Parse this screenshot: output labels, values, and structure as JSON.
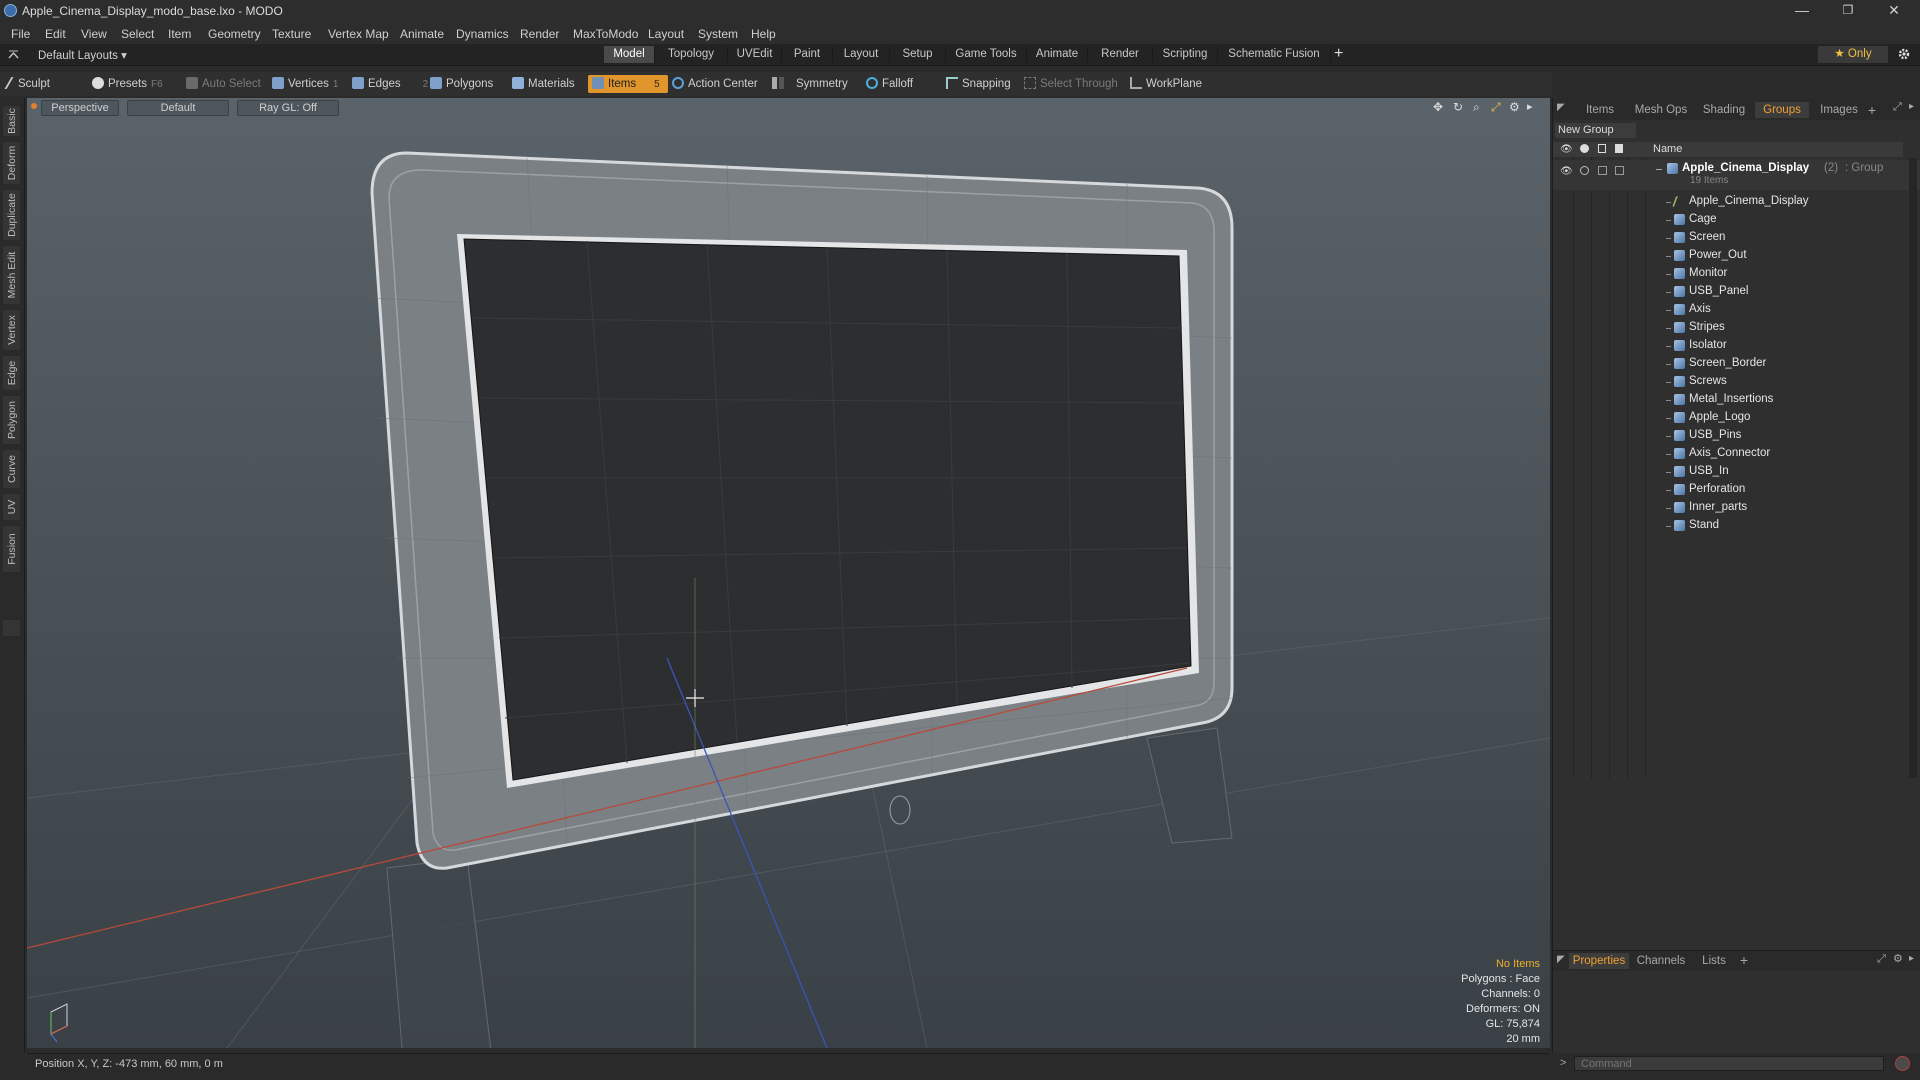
{
  "window": {
    "title": "Apple_Cinema_Display_modo_base.lxo - MODO",
    "controls": {
      "minimize": "—",
      "maximize": "❐",
      "close": "✕"
    }
  },
  "menu": [
    "File",
    "Edit",
    "View",
    "Select",
    "Item",
    "Geometry",
    "Texture",
    "Vertex Map",
    "Animate",
    "Dynamics",
    "Render",
    "MaxToModo",
    "Layout",
    "System",
    "Help"
  ],
  "layoutbar": {
    "layouts_label": "Default Layouts ▾",
    "tabs": [
      "Model",
      "Topology",
      "UVEdit",
      "Paint",
      "Layout",
      "Setup",
      "Game Tools",
      "Animate",
      "Render",
      "Scripting",
      "Schematic Fusion"
    ],
    "active_tab": "Model",
    "add_label": "+",
    "only_label": "★ Only"
  },
  "toolbar": {
    "sculpt": "Sculpt",
    "presets": "Presets",
    "presets_key": "F6",
    "auto_select": "Auto Select",
    "vertices": "Vertices",
    "vertices_key": "1",
    "edges": "Edges",
    "edges_key": "2",
    "polygons": "Polygons",
    "materials": "Materials",
    "items": "Items",
    "items_key": "5",
    "action_center": "Action Center",
    "symmetry": "Symmetry",
    "falloff": "Falloff",
    "snapping": "Snapping",
    "select_through": "Select Through",
    "workplane": "WorkPlane"
  },
  "lefttabs": [
    "Basic",
    "Deform",
    "Duplicate",
    "Mesh Edit",
    "Vertex",
    "Edge",
    "Polygon",
    "Curve",
    "UV",
    "Fusion"
  ],
  "viewport": {
    "view_label": "Perspective",
    "shading_label": "Default",
    "raygl_label": "Ray GL: Off",
    "info": {
      "selection": "No Items",
      "polygons": "Polygons : Face",
      "channels": "Channels: 0",
      "deformers": "Deformers: ON",
      "gl": "GL: 75,874",
      "unit": "20 mm"
    }
  },
  "statusbar": {
    "position": "Position X, Y, Z:  -473 mm, 60 mm, 0 m"
  },
  "rightpanel": {
    "tabs": [
      "Items",
      "Mesh Ops",
      "Shading",
      "Groups",
      "Images"
    ],
    "active_tab": "Groups",
    "add_tab": "+",
    "new_group": "New Group",
    "column_name": "Name",
    "group": {
      "name": "Apple_Cinema_Display",
      "count": "(2)",
      "type": ": Group",
      "sub": "19 Items"
    },
    "items": [
      "Apple_Cinema_Display",
      "Cage",
      "Screen",
      "Power_Out",
      "Monitor",
      "USB_Panel",
      "Axis",
      "Stripes",
      "Isolator",
      "Screen_Border",
      "Screws",
      "Metal_Insertions",
      "Apple_Logo",
      "USB_Pins",
      "Axis_Connector",
      "USB_In",
      "Perforation",
      "Inner_parts",
      "Stand"
    ],
    "bottom_tabs": [
      "Properties",
      "Channels",
      "Lists"
    ],
    "bottom_active": "Properties",
    "command_placeholder": "Command"
  },
  "colors": {
    "accent": "#f0a132",
    "active_button": "#e0962c",
    "x_axis": "#b84a3a",
    "z_axis": "#3a55b8"
  }
}
